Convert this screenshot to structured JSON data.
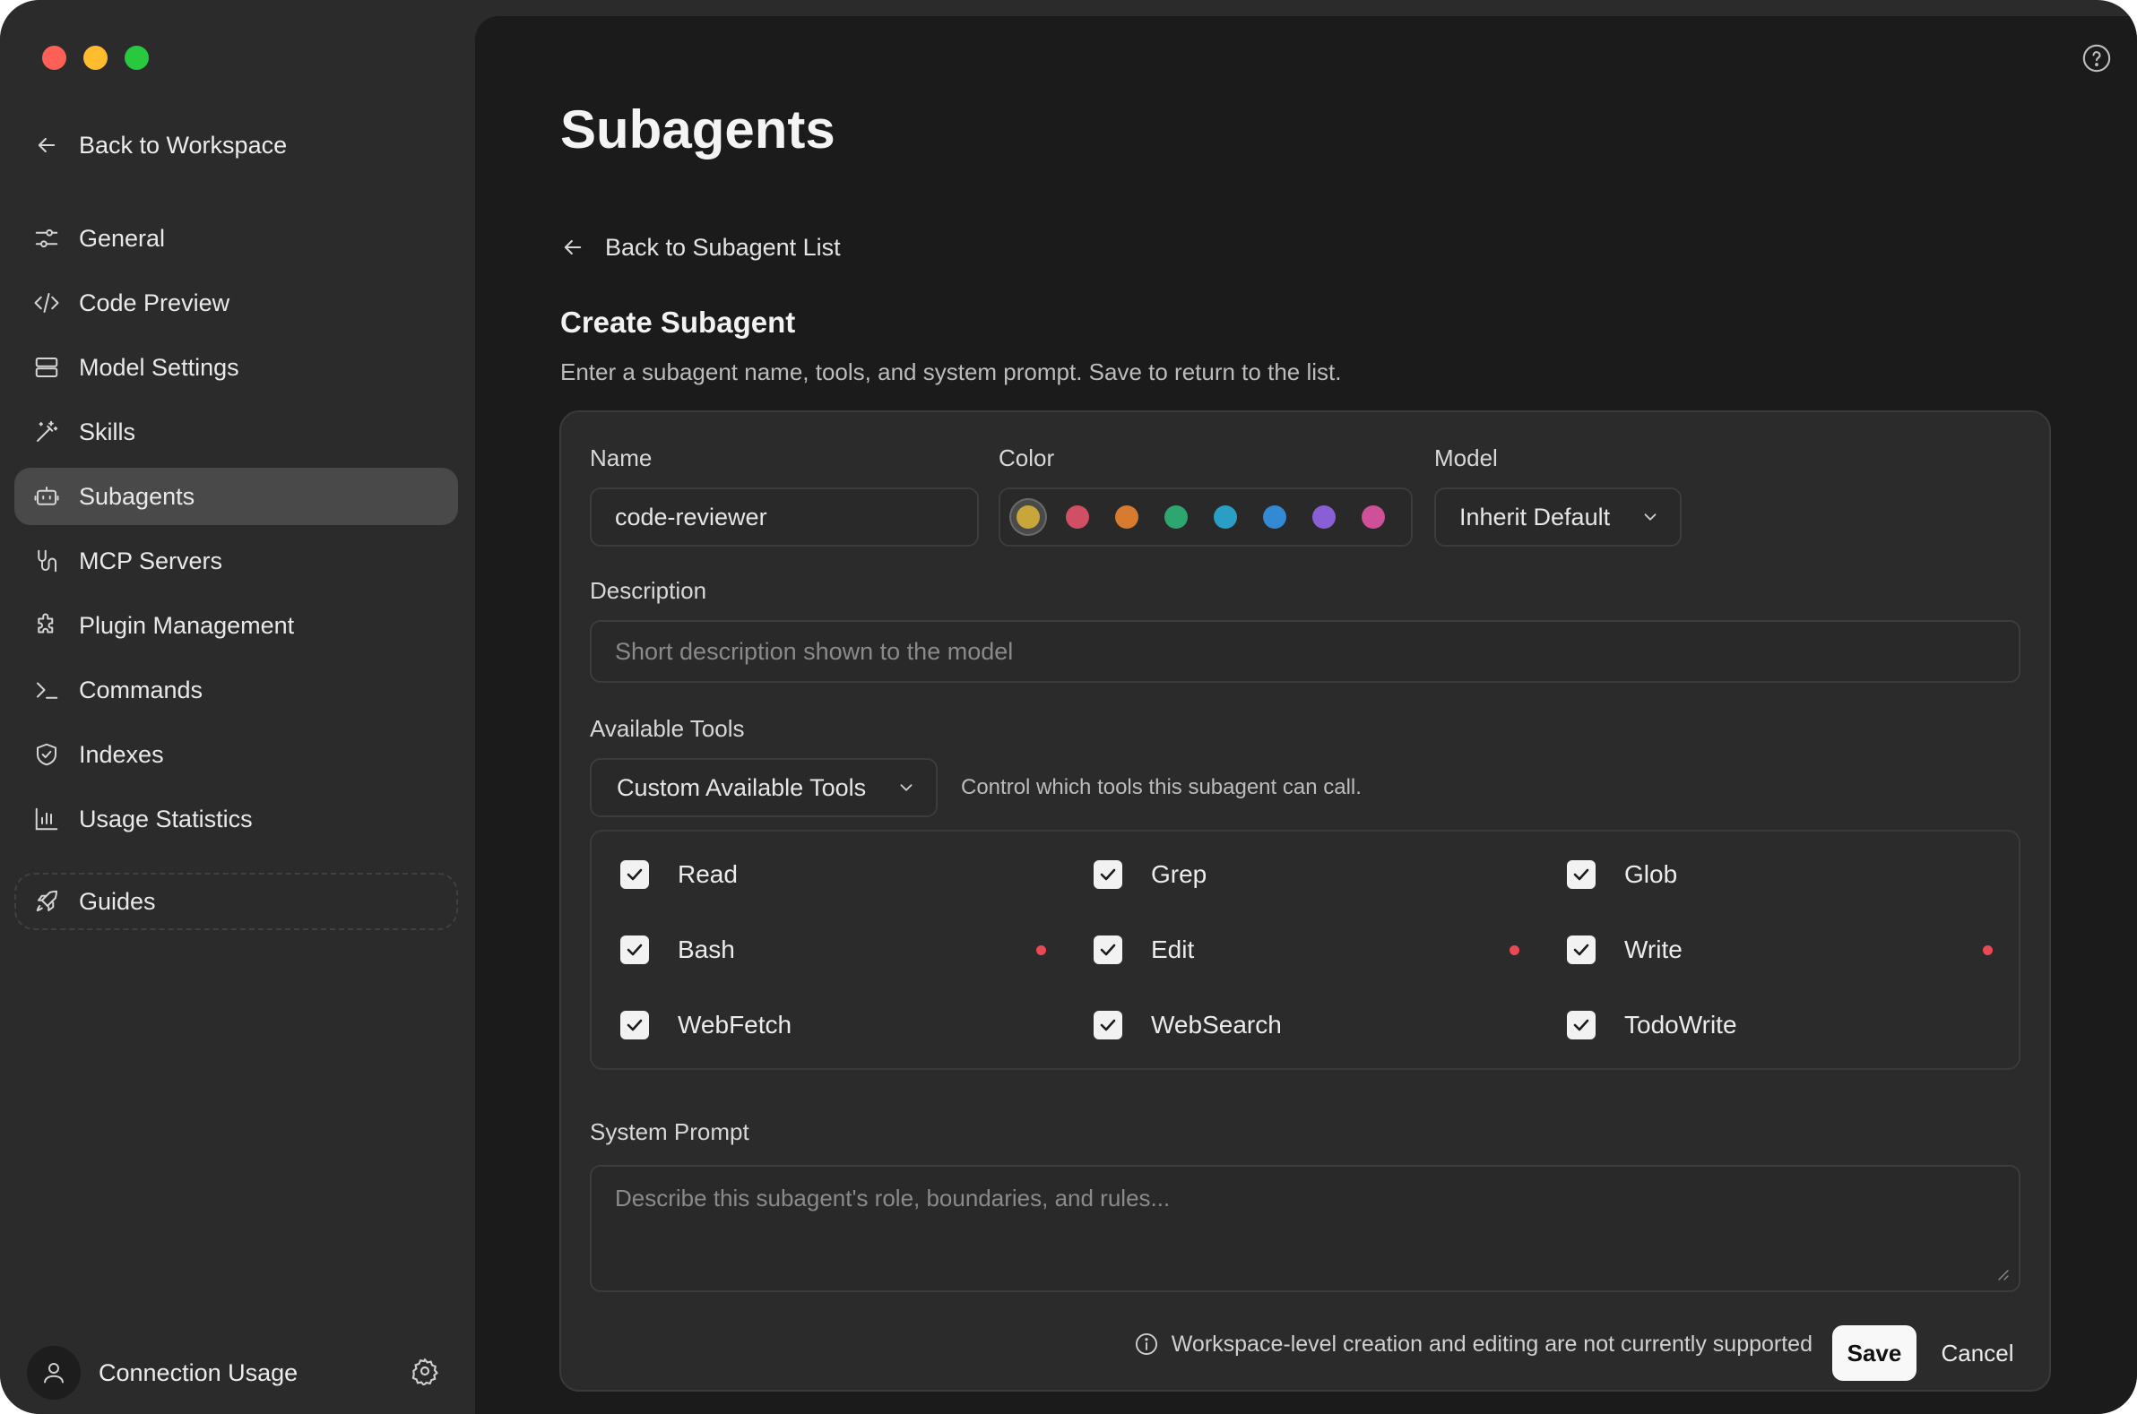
{
  "window": {
    "traffic_lights": [
      "#fe5f57",
      "#febc2e",
      "#28c840"
    ]
  },
  "sidebar": {
    "back_label": "Back to Workspace",
    "items": [
      {
        "label": "General",
        "icon": "sliders-icon"
      },
      {
        "label": "Code Preview",
        "icon": "code-icon"
      },
      {
        "label": "Model Settings",
        "icon": "server-icon"
      },
      {
        "label": "Skills",
        "icon": "magic-wand-icon"
      },
      {
        "label": "Subagents",
        "icon": "robot-icon",
        "active": true
      },
      {
        "label": "MCP Servers",
        "icon": "plug-icon"
      },
      {
        "label": "Plugin Management",
        "icon": "puzzle-icon"
      },
      {
        "label": "Commands",
        "icon": "terminal-icon"
      },
      {
        "label": "Indexes",
        "icon": "shield-icon"
      },
      {
        "label": "Usage Statistics",
        "icon": "bar-chart-icon"
      }
    ],
    "guides_label": "Guides",
    "connection_label": "Connection Usage"
  },
  "main": {
    "title": "Subagents",
    "back_label": "Back to Subagent List",
    "section_title": "Create Subagent",
    "section_desc": "Enter a subagent name, tools, and system prompt. Save to return to the list.",
    "form": {
      "name_label": "Name",
      "name_value": "code-reviewer",
      "color_label": "Color",
      "colors": [
        "#c9a63a",
        "#d04f64",
        "#d67b2f",
        "#2ea66f",
        "#2a9ec4",
        "#3389d4",
        "#8a5fd6",
        "#cf4f98"
      ],
      "selected_color": "#c9a63a",
      "model_label": "Model",
      "model_value": "Inherit Default",
      "description_label": "Description",
      "description_placeholder": "Short description shown to the model",
      "tools_label": "Available Tools",
      "tools_mode": "Custom Available Tools",
      "tools_hint": "Control  which tools this subagent can call.",
      "tools": [
        {
          "label": "Read",
          "checked": true,
          "warn": false
        },
        {
          "label": "Grep",
          "checked": true,
          "warn": false
        },
        {
          "label": "Glob",
          "checked": true,
          "warn": false
        },
        {
          "label": "Bash",
          "checked": true,
          "warn": true
        },
        {
          "label": "Edit",
          "checked": true,
          "warn": true
        },
        {
          "label": "Write",
          "checked": true,
          "warn": true
        },
        {
          "label": "WebFetch",
          "checked": true,
          "warn": false
        },
        {
          "label": "WebSearch",
          "checked": true,
          "warn": false
        },
        {
          "label": "TodoWrite",
          "checked": true,
          "warn": false
        }
      ],
      "prompt_label": "System Prompt",
      "prompt_placeholder": "Describe this subagent's role, boundaries, and rules...",
      "footer_note": "Workspace-level creation and editing are not currently supported",
      "save_label": "Save",
      "cancel_label": "Cancel"
    }
  }
}
